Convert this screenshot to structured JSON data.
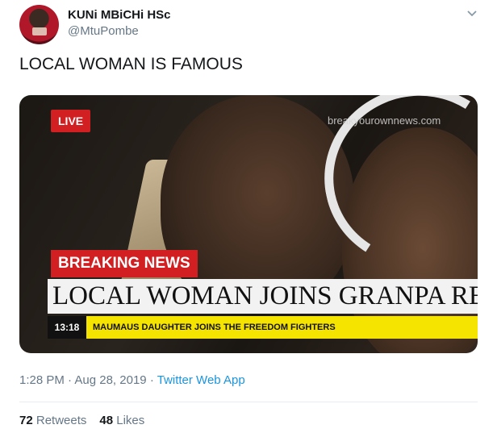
{
  "author": {
    "display_name": "KUNi MBiCHi HSc",
    "handle": "@MtuPombe"
  },
  "menu_icon": "chevron-down-icon",
  "tweet_text": "LOCAL WOMAN IS FAMOUS",
  "media": {
    "live_badge": "LIVE",
    "watermark": "breakyourownnews.com",
    "breaking_label": "BREAKING NEWS",
    "headline": "LOCAL WOMAN JOINS GRANPA RECORDS",
    "ticker_time": "13:18",
    "ticker_text": "MAUMAUS DAUGHTER JOINS THE FREEDOM FIGHTERS"
  },
  "meta": {
    "time": "1:28 PM",
    "date": "Aug 28, 2019",
    "separator": "·",
    "source": "Twitter Web App"
  },
  "stats": {
    "retweets_count": "72",
    "retweets_label": "Retweets",
    "likes_count": "48",
    "likes_label": "Likes"
  },
  "colors": {
    "accent": "#1b95e0",
    "breaking_red": "#d11f22",
    "ticker_yellow": "#f5e300"
  }
}
